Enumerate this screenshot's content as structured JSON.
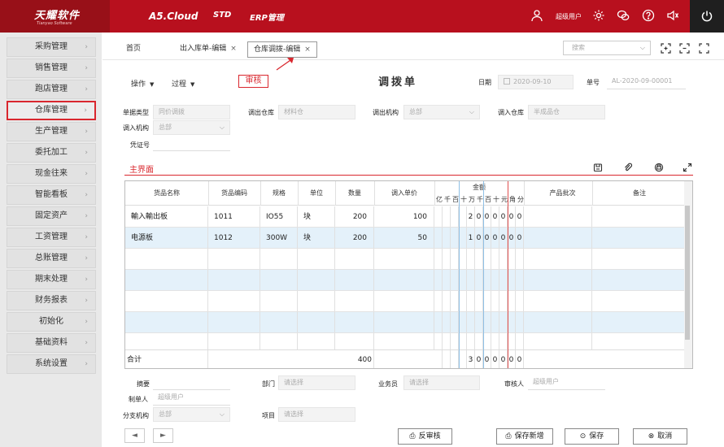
{
  "app": {
    "logo": "天耀软件",
    "logo_sub": "Tianyao Software",
    "product": "A5.Cloud",
    "edition": "STD",
    "module": "ERP管理",
    "username": "超级用户"
  },
  "sidebar": {
    "items": [
      {
        "label": "采购管理",
        "active": false
      },
      {
        "label": "销售管理",
        "active": false
      },
      {
        "label": "跑店管理",
        "active": false
      },
      {
        "label": "仓库管理",
        "active": true
      },
      {
        "label": "生产管理",
        "active": false
      },
      {
        "label": "委托加工",
        "active": false
      },
      {
        "label": "现金往来",
        "active": false
      },
      {
        "label": "智能看板",
        "active": false
      },
      {
        "label": "固定资产",
        "active": false
      },
      {
        "label": "工资管理",
        "active": false
      },
      {
        "label": "总账管理",
        "active": false
      },
      {
        "label": "期末处理",
        "active": false
      },
      {
        "label": "财务报表",
        "active": false
      },
      {
        "label": "初始化",
        "active": false
      },
      {
        "label": "基础资料",
        "active": false
      },
      {
        "label": "系统设置",
        "active": false
      }
    ]
  },
  "tabs": {
    "home": "首页",
    "inout": "出入库单-编辑",
    "transfer": "仓库调拨-编辑",
    "search_placeholder": "搜索"
  },
  "toolbar": {
    "operate": "操作",
    "process": "过程",
    "audit": "审核"
  },
  "form": {
    "title": "调拨单",
    "date_label": "日期",
    "date_value": "2020-09-10",
    "no_label": "单号",
    "no_value": "AL-2020-09-00001",
    "doc_type_label": "单据类型",
    "doc_type_value": "同价调拨",
    "out_wh_label": "调出仓库",
    "out_wh_value": "材料仓",
    "out_org_label": "调出机构",
    "out_org_value": "总部",
    "in_wh_label": "调入仓库",
    "in_wh_value": "半成品仓",
    "in_org_label": "调入机构",
    "in_org_value": "总部",
    "voucher_label": "凭证号",
    "voucher_value": ""
  },
  "grid": {
    "tab": "主界面",
    "headers": {
      "name": "货品名称",
      "code": "货品编码",
      "spec": "规格",
      "unit": "单位",
      "qty": "数量",
      "price": "调入单价",
      "amount": "金额",
      "batch": "产品批次",
      "note": "备注"
    },
    "amount_units": [
      "亿",
      "千",
      "百",
      "十",
      "万",
      "千",
      "百",
      "十",
      "元",
      "角",
      "分"
    ],
    "rows": [
      {
        "name": "輸入輸出板",
        "code": "1011",
        "spec": "IO55",
        "unit": "块",
        "qty": "200",
        "price": "100",
        "digits": [
          "",
          "",
          "",
          "",
          "2",
          "0",
          "0",
          "0",
          "0",
          "0",
          "0"
        ]
      },
      {
        "name": "电源板",
        "code": "1012",
        "spec": "300W",
        "unit": "块",
        "qty": "200",
        "price": "50",
        "digits": [
          "",
          "",
          "",
          "",
          "1",
          "0",
          "0",
          "0",
          "0",
          "0",
          "0"
        ]
      }
    ],
    "total_label": "合计",
    "total_qty": "400",
    "total_digits": [
      "",
      "",
      "",
      "",
      "3",
      "0",
      "0",
      "0",
      "0",
      "0",
      "0"
    ]
  },
  "footer": {
    "summary_label": "摘要",
    "summary_value": "",
    "dept_label": "部门",
    "dept_placeholder": "请选择",
    "staff_label": "业务员",
    "staff_placeholder": "请选择",
    "reviewer_label": "审核人",
    "reviewer_value": "超级用户",
    "maker_label": "制单人",
    "maker_value": "超级用户",
    "branch_label": "分支机构",
    "branch_value": "总部",
    "project_label": "项目",
    "project_placeholder": "请选择"
  },
  "buttons": {
    "unaudit": "反审核",
    "save_new": "保存新增",
    "save": "保存",
    "cancel": "取消",
    "prev": "◄",
    "next": "►"
  },
  "colors": {
    "brand": "#b8101e",
    "brand_dark": "#981018",
    "accent": "#d9272e",
    "row_alt": "#e4f1fa"
  }
}
